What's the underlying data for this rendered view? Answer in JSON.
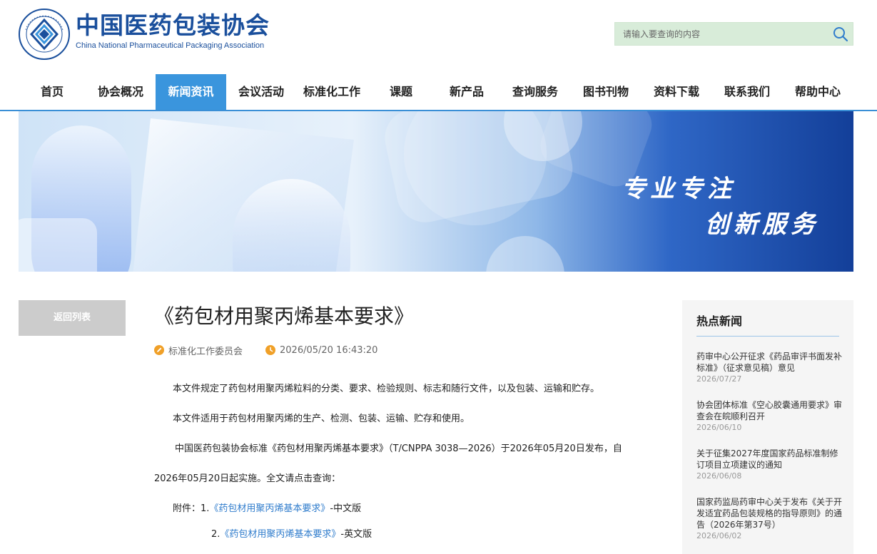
{
  "header": {
    "org_name_cn": "中国医药包装协会",
    "org_name_en": "China National Pharmaceutical Packaging Association",
    "search_placeholder": "请输入要查询的内容"
  },
  "nav": {
    "items": [
      {
        "label": "首页"
      },
      {
        "label": "协会概况"
      },
      {
        "label": "新闻资讯",
        "active": true
      },
      {
        "label": "会议活动"
      },
      {
        "label": "标准化工作"
      },
      {
        "label": "课题"
      },
      {
        "label": "新产品"
      },
      {
        "label": "查询服务"
      },
      {
        "label": "图书刊物"
      },
      {
        "label": "资料下载"
      },
      {
        "label": "联系我们"
      },
      {
        "label": "帮助中心"
      }
    ]
  },
  "banner": {
    "slogan_line1": "专业专注",
    "slogan_line2": "创新服务"
  },
  "sidebar": {
    "back_label": "返回列表"
  },
  "article": {
    "title": "《药包材用聚丙烯基本要求》",
    "source": "标准化工作委员会",
    "datetime": "2026/05/20 16:43:20",
    "para1": "本文件规定了药包材用聚丙烯粒料的分类、要求、检验规则、标志和随行文件，以及包装、运输和贮存。",
    "para2": "本文件适用于药包材用聚丙烯的生产、检测、包装、运输、贮存和使用。",
    "para3_line1": "中国医药包装协会标准《药包材用聚丙烯基本要求》（T/CNPPA 3038—2026）于2026年05月20日发布，自",
    "para3_line2": "2026年05月20日起实施。全文请点击查询：",
    "attachment_prefix": "附件：1.",
    "attachment1_link": "《药包材用聚丙烯基本要求》",
    "attachment1_suffix": "-中文版",
    "attachment2_prefix": "2.",
    "attachment2_link": "《药包材用聚丙烯基本要求》",
    "attachment2_suffix": "-英文版"
  },
  "hot_news": {
    "title": "热点新闻",
    "items": [
      {
        "title": "药审中心公开征求《药品审评书面发补标准》（征求意见稿）意见",
        "date": "2026/07/27"
      },
      {
        "title": "协会团体标准《空心胶囊通用要求》审查会在皖顺利召开",
        "date": "2026/06/10"
      },
      {
        "title": "关于征集2027年度国家药品标准制修订项目立项建议的通知",
        "date": "2026/06/08"
      },
      {
        "title": "国家药监局药审中心关于发布《关于开发适宜药品包装规格的指导原则》的通告（2026年第37号）",
        "date": "2026/06/02"
      }
    ]
  },
  "colors": {
    "brand_blue": "#1a4f9c",
    "nav_active": "#3a95dd",
    "link": "#2f7ccc",
    "search_bg": "#d8ecd9"
  }
}
